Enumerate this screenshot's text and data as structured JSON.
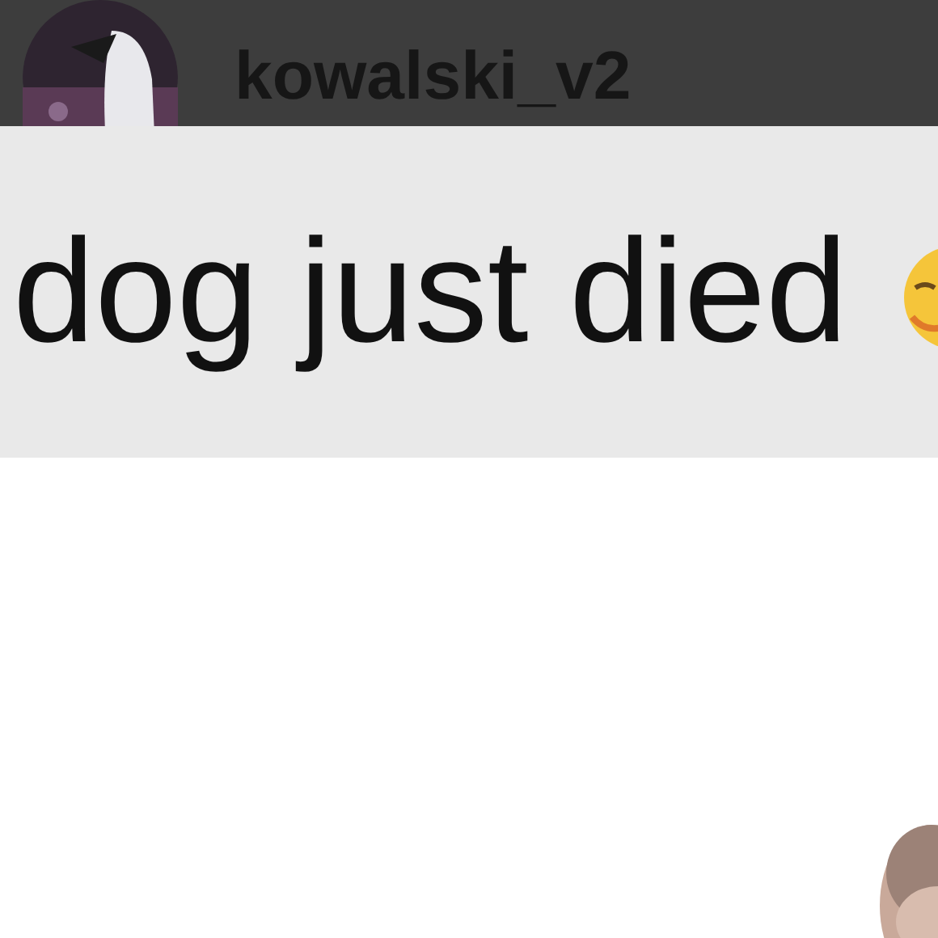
{
  "header": {
    "username": "kowalski_v2"
  },
  "message": {
    "text": "dog just died"
  }
}
